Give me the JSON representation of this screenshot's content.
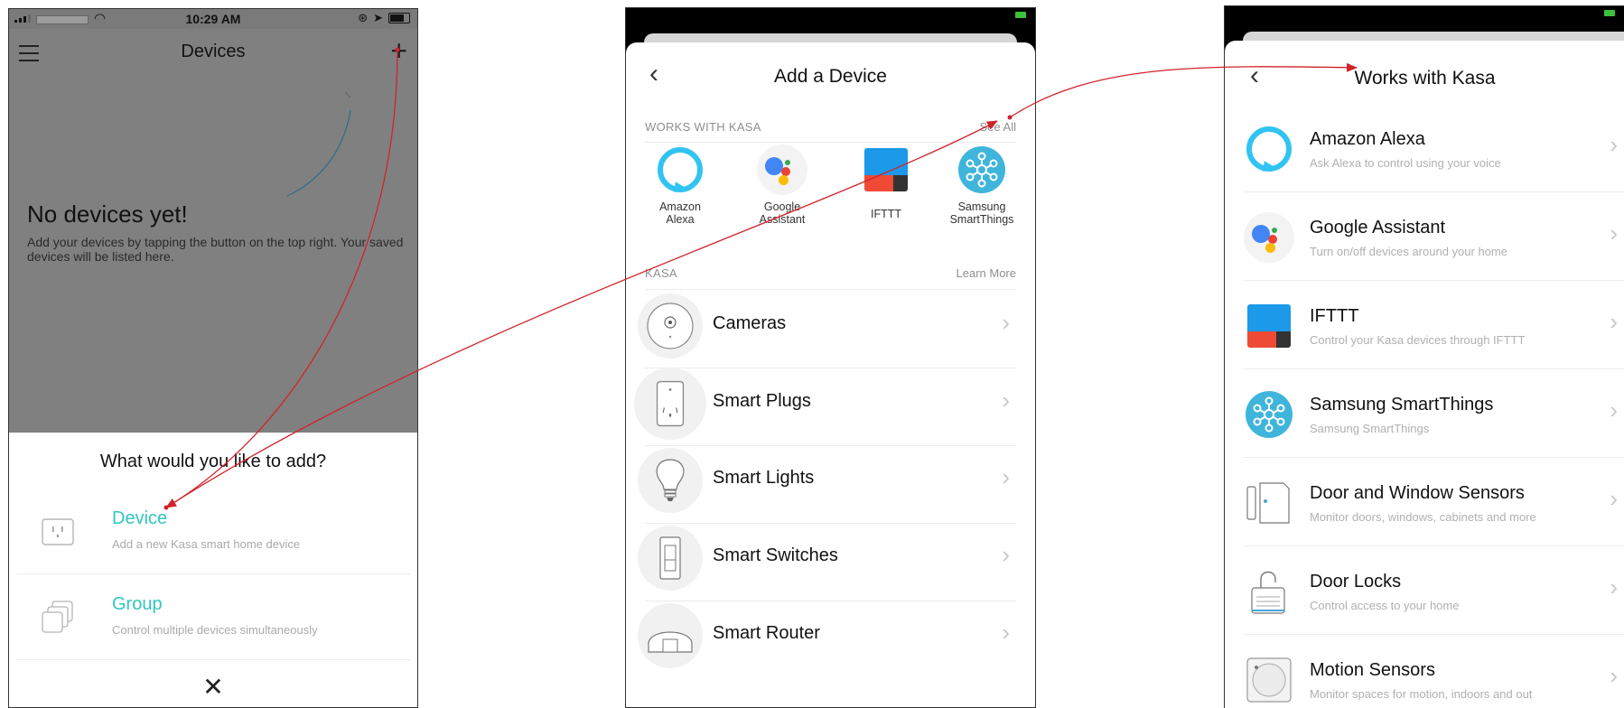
{
  "screen1": {
    "status_time": "10:29 AM",
    "nav_title": "Devices",
    "empty_title": "No devices yet!",
    "empty_desc": "Add your devices by tapping the button on the top right.  Your saved devices will be listed here.",
    "sheet_question": "What would you like to add?",
    "options": [
      {
        "label": "Device",
        "sub": "Add a new Kasa smart home device"
      },
      {
        "label": "Group",
        "sub": "Control multiple devices simultaneously"
      }
    ],
    "close_glyph": "✕"
  },
  "screen2": {
    "title": "Add a Device",
    "works_section": "WORKS WITH KASA",
    "see_all": "See All",
    "partners": [
      {
        "name": "Amazon\nAlexa",
        "icon": "alexa-icon"
      },
      {
        "name": "Google\nAssistant",
        "icon": "google-assistant-icon"
      },
      {
        "name": "IFTTT",
        "icon": "ifttt-icon"
      },
      {
        "name": "Samsung\nSmartThings",
        "icon": "smartthings-icon"
      }
    ],
    "kasa_section": "KASA",
    "learn_more": "Learn More",
    "categories": [
      {
        "label": "Cameras",
        "icon": "camera-icon"
      },
      {
        "label": "Smart Plugs",
        "icon": "plug-icon"
      },
      {
        "label": "Smart Lights",
        "icon": "bulb-icon"
      },
      {
        "label": "Smart Switches",
        "icon": "switch-icon"
      },
      {
        "label": "Smart Router",
        "icon": "router-icon"
      }
    ]
  },
  "screen3": {
    "title": "Works with Kasa",
    "rows": [
      {
        "label": "Amazon Alexa",
        "sub": "Ask Alexa to control using your voice",
        "icon": "alexa-icon"
      },
      {
        "label": "Google Assistant",
        "sub": "Turn on/off devices around your home",
        "icon": "google-assistant-icon"
      },
      {
        "label": "IFTTT",
        "sub": "Control your Kasa devices through IFTTT",
        "icon": "ifttt-icon"
      },
      {
        "label": "Samsung SmartThings",
        "sub": "Samsung SmartThings",
        "icon": "smartthings-icon"
      },
      {
        "label": "Door and Window Sensors",
        "sub": "Monitor doors, windows, cabinets and more",
        "icon": "door-sensor-icon"
      },
      {
        "label": "Door Locks",
        "sub": "Control access to your home",
        "icon": "lock-icon"
      },
      {
        "label": "Motion Sensors",
        "sub": "Monitor spaces for motion, indoors and out",
        "icon": "motion-sensor-icon"
      }
    ]
  },
  "colors": {
    "accent": "#2fc7c0",
    "arrow": "#d0232a",
    "alexa": "#31c4f3",
    "smartthings": "#3fb5dc"
  }
}
